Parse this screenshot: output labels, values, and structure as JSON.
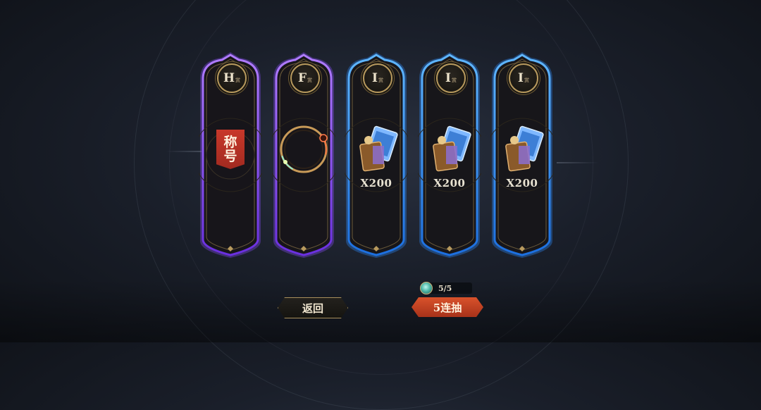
{
  "cards": [
    {
      "grade": "H",
      "grade_suffix": "赏",
      "rarity": "purple",
      "glow": "#8a4dff",
      "reward_icon": "title-tag-icon",
      "reward_text_1": "称",
      "reward_text_2": "号",
      "quantity": ""
    },
    {
      "grade": "F",
      "grade_suffix": "赏",
      "rarity": "purple",
      "glow": "#8a4dff",
      "reward_icon": "ring-halo-icon",
      "quantity": ""
    },
    {
      "grade": "I",
      "grade_suffix": "赏",
      "rarity": "blue",
      "glow": "#2e8dff",
      "reward_icon": "card-bundle-icon",
      "quantity": "X200"
    },
    {
      "grade": "I",
      "grade_suffix": "赏",
      "rarity": "blue",
      "glow": "#2e8dff",
      "reward_icon": "card-bundle-icon",
      "quantity": "X200"
    },
    {
      "grade": "I",
      "grade_suffix": "赏",
      "rarity": "blue",
      "glow": "#2e8dff",
      "reward_icon": "card-bundle-icon",
      "quantity": "X200"
    }
  ],
  "buttons": {
    "back_label": "返回",
    "draw_label": "5连抽"
  },
  "cost": {
    "icon": "currency-coin-icon",
    "text": "5/5"
  },
  "colors": {
    "purple_glow": "#8a4dff",
    "blue_glow": "#2e8dff",
    "draw_button": "#c8441f",
    "gold_trim": "#b89a5e"
  }
}
